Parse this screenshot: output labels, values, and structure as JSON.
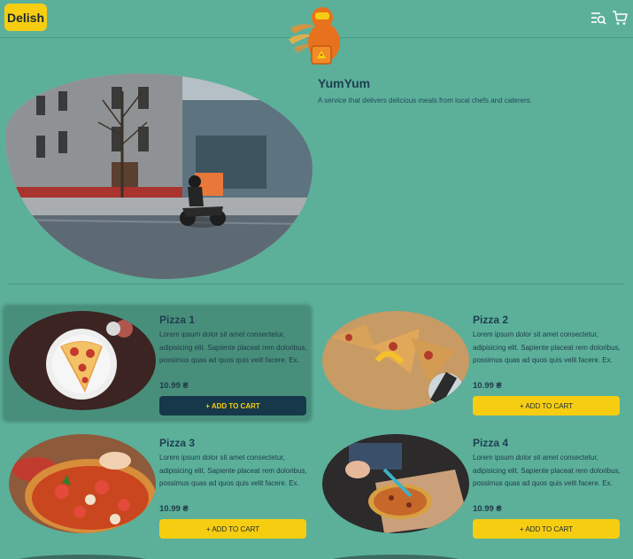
{
  "header": {
    "logo_label": "Delish",
    "mascot_icon": "delivery-mascot-icon",
    "search_icon": "search-menu-icon",
    "cart_icon": "cart-icon"
  },
  "hero": {
    "title": "YumYum",
    "description": "A service that delivers delicious meals from local chefs and caterers."
  },
  "products": [
    {
      "name": "Pizza 1",
      "description": "Lorem ipsum dolor sit amet consectetur, adipisicing elit. Sapiente placeat rem doloribus, possimus quas ad quos quis velit facere. Ex.",
      "price": "10.99 ₴",
      "button": "+ ADD TO CART"
    },
    {
      "name": "Pizza 2",
      "description": "Lorem ipsum dolor sit amet consectetur, adipisicing elit. Sapiente placeat rem doloribus, possimus quas ad quos quis velit facere. Ex.",
      "price": "10.99 ₴",
      "button": "+ ADD TO CART"
    },
    {
      "name": "Pizza 3",
      "description": "Lorem ipsum dolor sit amet consectetur, adipisicing elit. Sapiente placeat rem doloribus, possimus quas ad quos quis velit facere. Ex.",
      "price": "10.99 ₴",
      "button": "+ ADD TO CART"
    },
    {
      "name": "Pizza 4",
      "description": "Lorem ipsum dolor sit amet consectetur, adipisicing elit. Sapiente placeat rem doloribus, possimus quas ad quos quis velit facere. Ex.",
      "price": "10.99 ₴",
      "button": "+ ADD TO CART"
    }
  ],
  "colors": {
    "background": "#5cb09a",
    "accent": "#f7cd12",
    "dark": "#16384a"
  }
}
